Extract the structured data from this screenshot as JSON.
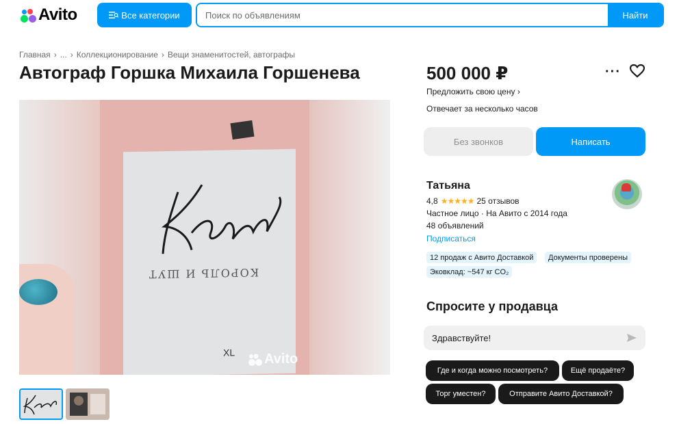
{
  "header": {
    "logo_text": "Avito",
    "categories_label": "Все категории",
    "search_placeholder": "Поиск по объявлениям",
    "search_button": "Найти",
    "accent_color": "#0099f7"
  },
  "breadcrumbs": [
    "Главная",
    "›",
    "...",
    "›",
    "Коллекционирование",
    "›",
    "Вещи знаменитостей, автографы"
  ],
  "listing": {
    "title": "Автограф Горшка Михаила Горшенева",
    "watermark": "Avito",
    "card_text": "КОРОЛЬ И ШУТ",
    "card_bottom": "XL"
  },
  "offer": {
    "price": "500 000 ₽",
    "offer_link": "Предложить свою цену ›",
    "responds": "Отвечает за несколько часов",
    "no_calls_label": "Без звонков",
    "write_label": "Написать"
  },
  "seller": {
    "name": "Татьяна",
    "rating": "4,8",
    "stars": "★★★★★",
    "reviews": "25 отзывов",
    "info": "Частное лицо · На Авито с 2014 года",
    "listings": "48 объявлений",
    "subscribe": "Подписаться",
    "badges": [
      "12 продаж с Авито Доставкой",
      "Документы проверены",
      "Эковклад: ~547 кг CO₂"
    ]
  },
  "ask": {
    "title": "Спросите у продавца",
    "input_value": "Здравствуйте!",
    "chips": [
      "Где и когда можно посмотреть?",
      "Ещё продаёте?",
      "Торг уместен?",
      "Отправите Авито Доставкой?"
    ]
  }
}
